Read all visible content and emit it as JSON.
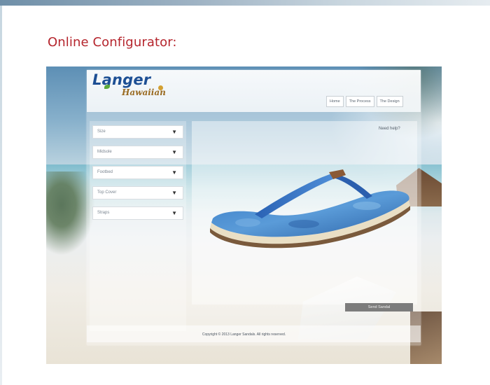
{
  "page": {
    "heading": "Online Configurator:"
  },
  "configurator": {
    "logo_main": "Langer",
    "logo_sub": "Hawaiian",
    "nav_tabs": [
      "Home",
      "The Process",
      "The Design"
    ],
    "dropdowns": [
      {
        "label": "Size"
      },
      {
        "label": "Midsole"
      },
      {
        "label": "Footbed"
      },
      {
        "label": "Top Cover"
      },
      {
        "label": "Straps"
      }
    ],
    "help_link": "Need help?",
    "send_button": "Send Sandal",
    "footer": "Copyright © 2013 Langer Sandals. All rights reserved."
  },
  "colors": {
    "heading": "#b5252d",
    "logo": "#1d4f94",
    "sandal_strap": "#2f6fc4",
    "sole_top": "#4a8ed2"
  }
}
